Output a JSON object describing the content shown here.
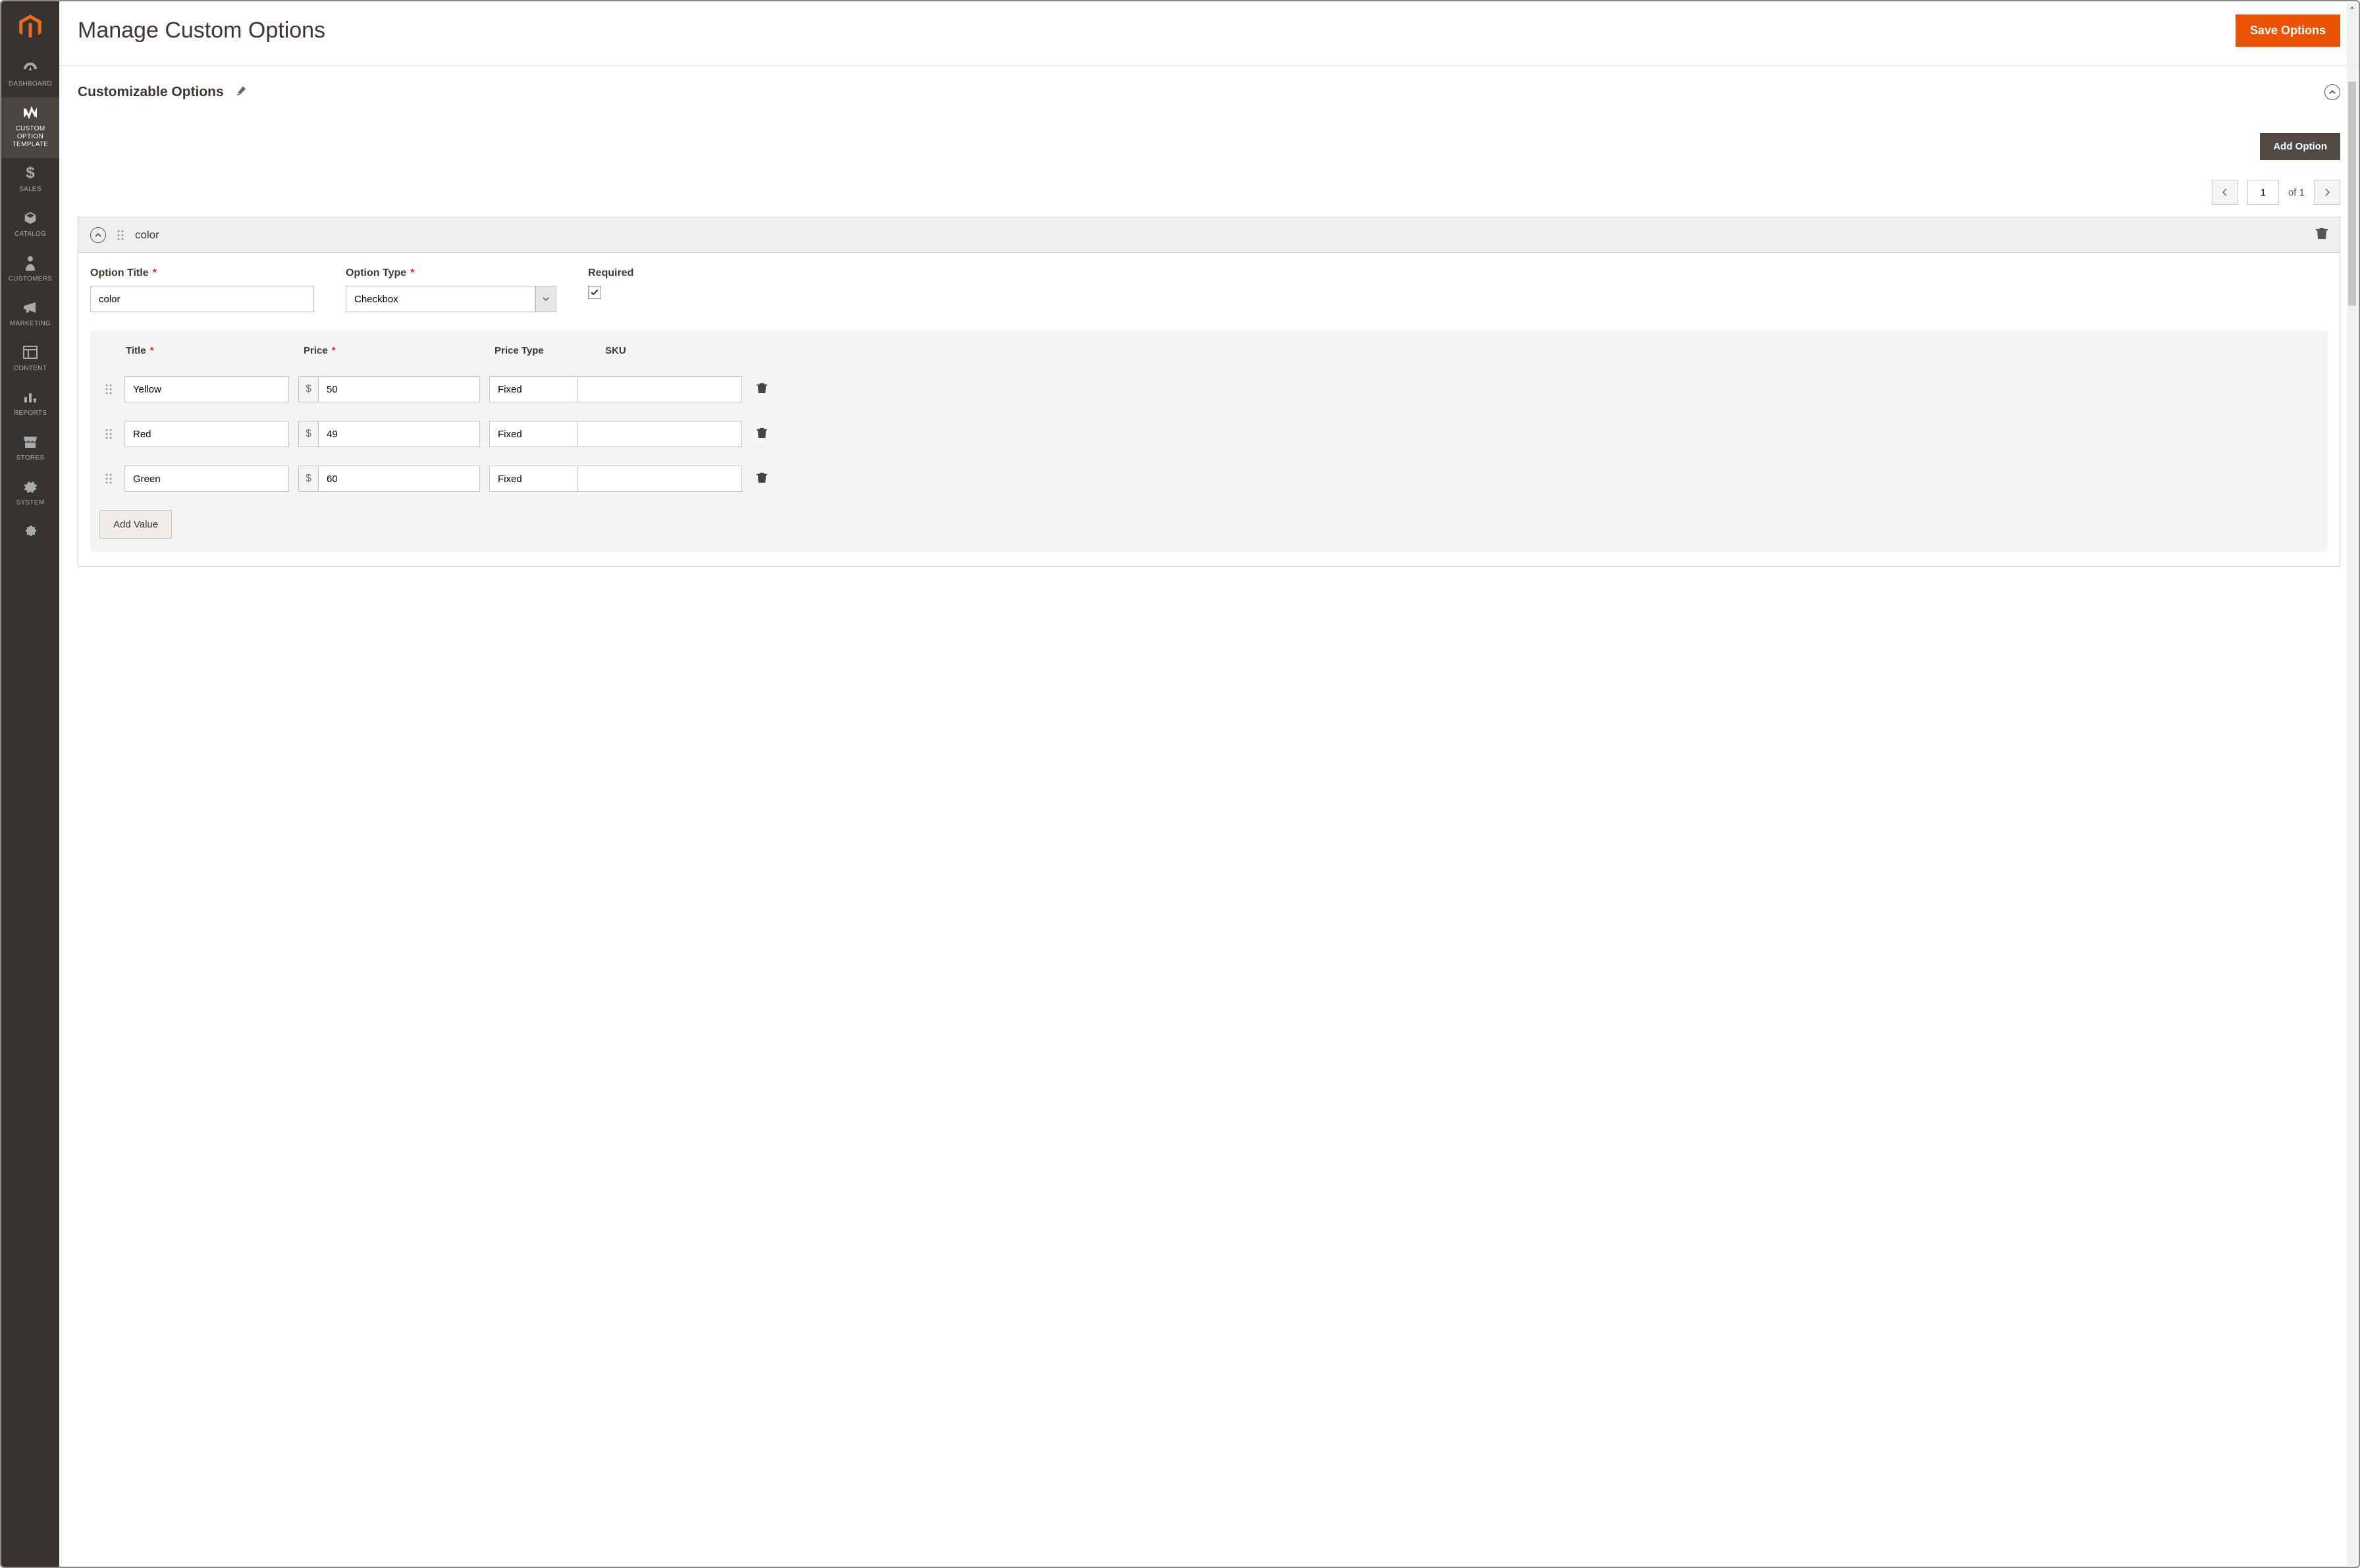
{
  "sidebar": {
    "items": [
      {
        "label": "DASHBOARD"
      },
      {
        "label": "CUSTOM OPTION TEMPLATE"
      },
      {
        "label": "SALES"
      },
      {
        "label": "CATALOG"
      },
      {
        "label": "CUSTOMERS"
      },
      {
        "label": "MARKETING"
      },
      {
        "label": "CONTENT"
      },
      {
        "label": "REPORTS"
      },
      {
        "label": "STORES"
      },
      {
        "label": "SYSTEM"
      }
    ]
  },
  "header": {
    "title": "Manage Custom Options",
    "save_label": "Save Options"
  },
  "section": {
    "title": "Customizable Options",
    "add_option_label": "Add Option"
  },
  "pager": {
    "page": "1",
    "of_text": "of 1"
  },
  "option": {
    "name": "color",
    "fields": {
      "title_label": "Option Title",
      "title_value": "color",
      "type_label": "Option Type",
      "type_value": "Checkbox",
      "required_label": "Required"
    },
    "table": {
      "headers": {
        "title": "Title",
        "price": "Price",
        "price_type": "Price Type",
        "sku": "SKU"
      },
      "currency": "$",
      "rows": [
        {
          "title": "Yellow",
          "price": "50",
          "price_type": "Fixed",
          "sku": ""
        },
        {
          "title": "Red",
          "price": "49",
          "price_type": "Fixed",
          "sku": ""
        },
        {
          "title": "Green",
          "price": "60",
          "price_type": "Fixed",
          "sku": ""
        }
      ],
      "add_value_label": "Add Value"
    }
  }
}
